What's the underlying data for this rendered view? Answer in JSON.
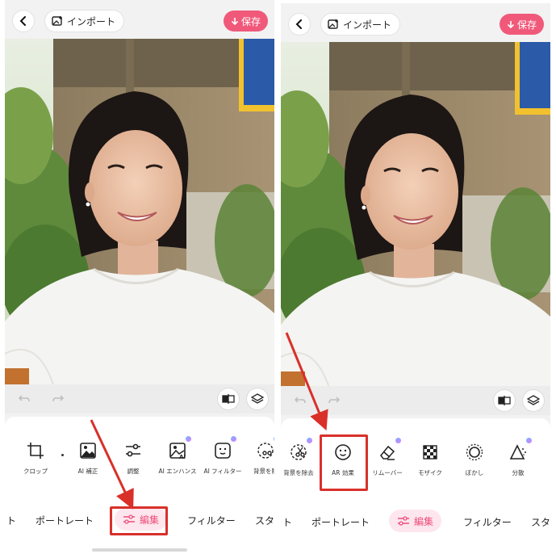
{
  "left_screen": {
    "header": {
      "import_label": "インポート",
      "save_label": "保存"
    },
    "tools": [
      {
        "label": "クロップ",
        "icon": "crop-icon"
      },
      {
        "label": "AI 補正",
        "icon": "ai-enhance-image-icon"
      },
      {
        "label": "調整",
        "icon": "sliders-icon"
      },
      {
        "label": "AI エンハンス",
        "icon": "ai-image-icon"
      },
      {
        "label": "AI フィルター",
        "icon": "ai-face-filter-icon"
      },
      {
        "label": "背景を除",
        "icon": "remove-background-icon"
      }
    ],
    "tabs": [
      {
        "label": "ト"
      },
      {
        "label": "ポートレート"
      },
      {
        "label": "編集",
        "active": true
      },
      {
        "label": "フィルター"
      },
      {
        "label": "スタ"
      }
    ]
  },
  "right_screen": {
    "header": {
      "import_label": "インポート",
      "save_label": "保存"
    },
    "tools": [
      {
        "label": "背景を除去",
        "icon": "remove-background-icon"
      },
      {
        "label": "AR 効果",
        "icon": "smiley-face-icon"
      },
      {
        "label": "リムーバー",
        "icon": "eraser-icon"
      },
      {
        "label": "モザイク",
        "icon": "mosaic-icon"
      },
      {
        "label": "ぼかし",
        "icon": "blur-icon"
      },
      {
        "label": "分散",
        "icon": "dispersion-icon"
      }
    ],
    "tabs": [
      {
        "label": "ト"
      },
      {
        "label": "ポートレート"
      },
      {
        "label": "編集",
        "active": true
      },
      {
        "label": "フィルター"
      },
      {
        "label": "スタ"
      }
    ]
  },
  "colors": {
    "accent": "#f0597a",
    "highlight": "#d9302a",
    "active_tab_bg": "#fde6ee"
  }
}
